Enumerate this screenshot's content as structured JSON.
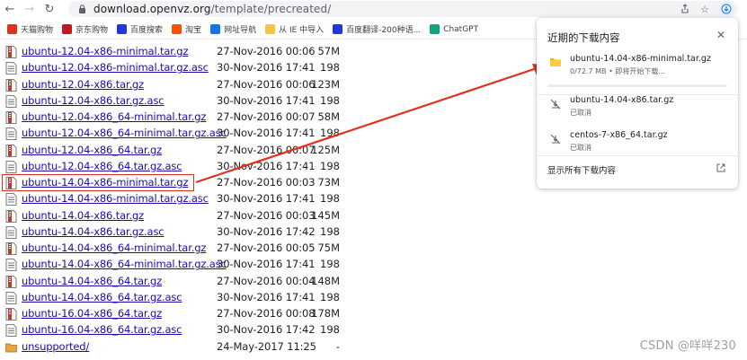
{
  "browser": {
    "url_host": "download.openvz.org",
    "url_path": "/template/precreated/"
  },
  "bookmarks": [
    {
      "label": "天猫购物",
      "color": "#e0301e"
    },
    {
      "label": "京东购物",
      "color": "#c81623"
    },
    {
      "label": "百度搜索",
      "color": "#2932e1"
    },
    {
      "label": "淘宝",
      "color": "#ff5000"
    },
    {
      "label": "网址导航",
      "color": "#1a73e8"
    },
    {
      "label": "从 IE 中导入",
      "color": "#f4c542"
    },
    {
      "label": "百度翻译-200种语...",
      "color": "#2932e1"
    },
    {
      "label": "ChatGPT",
      "color": "#10a37f"
    }
  ],
  "files": [
    {
      "name": "ubuntu-12.04-x86-minimal.tar.gz",
      "date": "27-Nov-2016 00:06",
      "size": "57M",
      "icon": "archive"
    },
    {
      "name": "ubuntu-12.04-x86-minimal.tar.gz.asc",
      "date": "30-Nov-2016 17:41",
      "size": "198",
      "icon": "text"
    },
    {
      "name": "ubuntu-12.04-x86.tar.gz",
      "date": "27-Nov-2016 00:06",
      "size": "123M",
      "icon": "archive"
    },
    {
      "name": "ubuntu-12.04-x86.tar.gz.asc",
      "date": "30-Nov-2016 17:41",
      "size": "198",
      "icon": "text"
    },
    {
      "name": "ubuntu-12.04-x86_64-minimal.tar.gz",
      "date": "27-Nov-2016 00:07",
      "size": "58M",
      "icon": "archive"
    },
    {
      "name": "ubuntu-12.04-x86_64-minimal.tar.gz.asc",
      "date": "30-Nov-2016 17:41",
      "size": "198",
      "icon": "text"
    },
    {
      "name": "ubuntu-12.04-x86_64.tar.gz",
      "date": "27-Nov-2016 00:07",
      "size": "125M",
      "icon": "archive"
    },
    {
      "name": "ubuntu-12.04-x86_64.tar.gz.asc",
      "date": "30-Nov-2016 17:41",
      "size": "198",
      "icon": "text"
    },
    {
      "name": "ubuntu-14.04-x86-minimal.tar.gz",
      "date": "27-Nov-2016 00:03",
      "size": "73M",
      "icon": "archive"
    },
    {
      "name": "ubuntu-14.04-x86-minimal.tar.gz.asc",
      "date": "30-Nov-2016 17:41",
      "size": "198",
      "icon": "text"
    },
    {
      "name": "ubuntu-14.04-x86.tar.gz",
      "date": "27-Nov-2016 00:03",
      "size": "145M",
      "icon": "archive"
    },
    {
      "name": "ubuntu-14.04-x86.tar.gz.asc",
      "date": "30-Nov-2016 17:42",
      "size": "198",
      "icon": "text"
    },
    {
      "name": "ubuntu-14.04-x86_64-minimal.tar.gz",
      "date": "27-Nov-2016 00:05",
      "size": "75M",
      "icon": "archive"
    },
    {
      "name": "ubuntu-14.04-x86_64-minimal.tar.gz.asc",
      "date": "30-Nov-2016 17:41",
      "size": "198",
      "icon": "text"
    },
    {
      "name": "ubuntu-14.04-x86_64.tar.gz",
      "date": "27-Nov-2016 00:04",
      "size": "148M",
      "icon": "archive"
    },
    {
      "name": "ubuntu-14.04-x86_64.tar.gz.asc",
      "date": "30-Nov-2016 17:41",
      "size": "198",
      "icon": "text"
    },
    {
      "name": "ubuntu-16.04-x86_64.tar.gz",
      "date": "27-Nov-2016 00:08",
      "size": "178M",
      "icon": "archive"
    },
    {
      "name": "ubuntu-16.04-x86_64.tar.gz.asc",
      "date": "30-Nov-2016 17:42",
      "size": "198",
      "icon": "text"
    },
    {
      "name": "unsupported/",
      "date": "24-May-2017 11:25",
      "size": "-",
      "icon": "folder"
    }
  ],
  "downloads": {
    "title": "近期的下载内容",
    "items": [
      {
        "name": "ubuntu-14.04-x86-minimal.tar.gz",
        "status": "0/72.7 MB • 即将开始下载...",
        "icon": "folder-icon",
        "progress": 0.0
      },
      {
        "name": "ubuntu-14.04-x86.tar.gz",
        "status": "已取消",
        "icon": "cancelled-icon"
      },
      {
        "name": "centos-7-x86_64.tar.gz",
        "status": "已取消",
        "icon": "cancelled-icon"
      }
    ],
    "show_all": "显示所有下载内容"
  },
  "watermark": "CSDN @咩咩230",
  "colors": {
    "link": "#1a0dab",
    "highlight": "#e0301e",
    "arrow": "#e0301e"
  }
}
